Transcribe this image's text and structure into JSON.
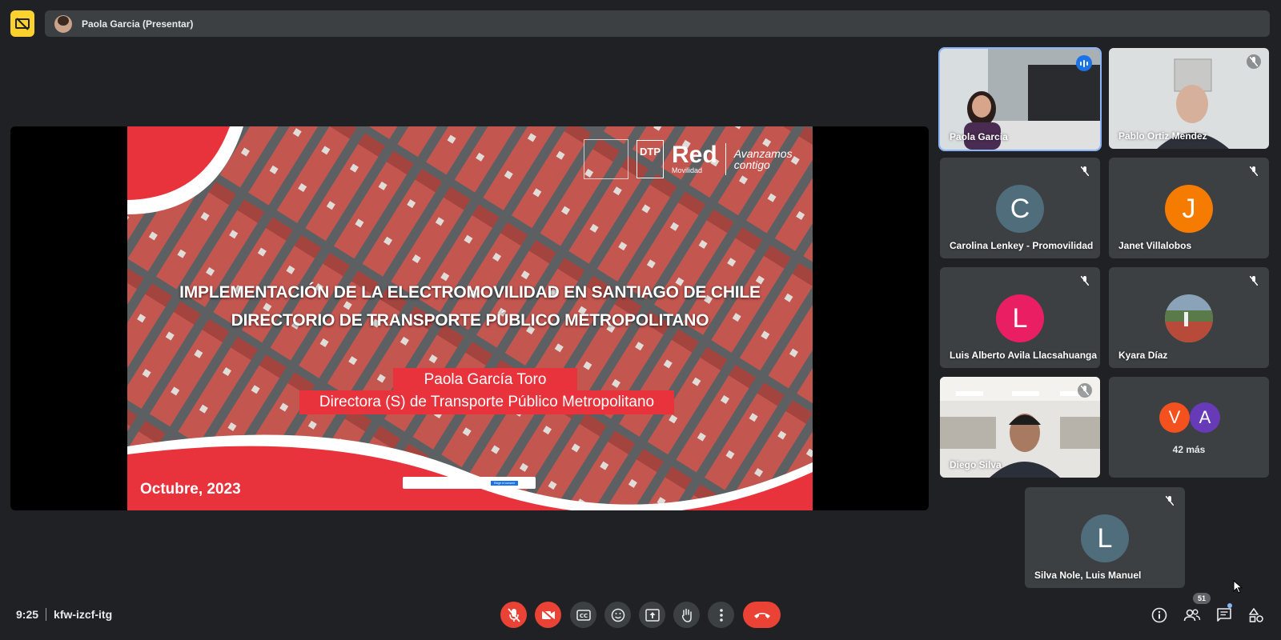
{
  "header": {
    "presenter_label": "Paola Garcia (Presentar)"
  },
  "slide": {
    "title_line1": "IMPLEMENTACIÓN DE LA ELECTROMOVILIDAD EN SANTIAGO DE CHILE",
    "title_line2": "DIRECTORIO DE TRANSPORTE PÚBLICO METROPOLITANO",
    "presenter_name": "Paola García Toro",
    "presenter_role": "Directora (S) de Transporte Público Metropolitano",
    "date": "Octubre, 2023",
    "logo_dtp": "DTP",
    "logo_red": "Red",
    "logo_red_sub": "Movilidad",
    "logo_tagline_1": "Avanzamos",
    "logo_tagline_2": "contigo",
    "cookie_button": "Elegir el consent"
  },
  "participants": [
    {
      "name": "Paola Garcia",
      "type": "video",
      "speaking": true
    },
    {
      "name": "Pablo Ortiz Mendez",
      "type": "video",
      "muted": true
    },
    {
      "name": "Carolina Lenkey - Promovilidad",
      "initial": "C",
      "color": "#4f6d7a",
      "muted": true
    },
    {
      "name": "Janet Villalobos",
      "initial": "J",
      "color": "#f57c00",
      "muted": true
    },
    {
      "name": "Luis Alberto Avila Llacsahuanga",
      "initial": "L",
      "color": "#e91e63",
      "muted": true
    },
    {
      "name": "Kyara Díaz",
      "type": "photo",
      "muted": true
    },
    {
      "name": "Diego Silva",
      "type": "video",
      "muted": true
    },
    {
      "name": "Silva Nole, Luis Manuel",
      "initial": "L",
      "color": "#4f6d7a",
      "muted": true
    }
  ],
  "more": {
    "initials": [
      "V",
      "A"
    ],
    "colors": [
      "#f4511e",
      "#673ab7"
    ],
    "label": "42 más"
  },
  "footer": {
    "time": "9:25",
    "meeting_code": "kfw-izcf-itg",
    "people_count": "51"
  },
  "colors": {
    "background": "#202124",
    "tile": "#3c4043",
    "danger": "#ea4335",
    "accent": "#8ab4f8",
    "presenting_badge": "#fbd12e"
  }
}
